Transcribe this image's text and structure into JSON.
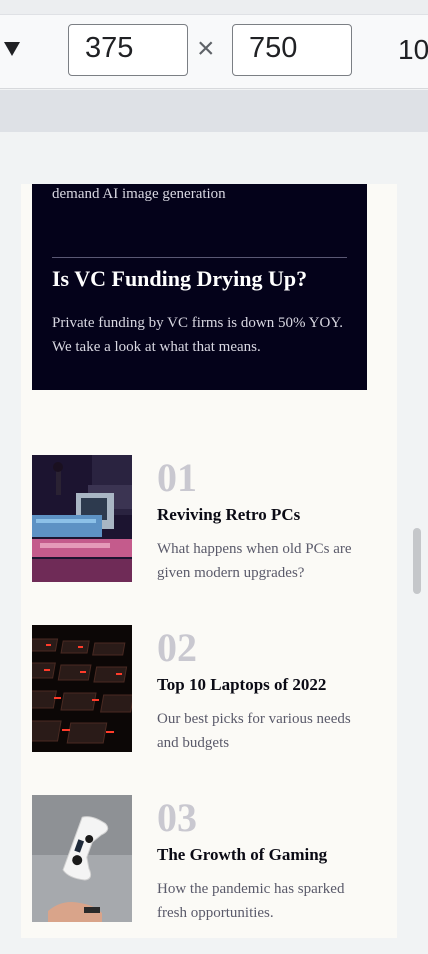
{
  "devtools": {
    "width_value": "375",
    "height_value": "750",
    "times_symbol": "×",
    "zoom_text": "10"
  },
  "featured": {
    "prev_description": "What are the possible adverse effects of on-demand AI image generation",
    "title": "Is VC Funding Drying Up?",
    "description": "Private funding by VC firms is down 50% YOY. We take a look at what that means."
  },
  "articles": [
    {
      "number": "01",
      "title": "Reviving Retro PCs",
      "description": "What happens when old PCs are given modern upgrades?",
      "image": "retro-pc-image"
    },
    {
      "number": "02",
      "title": "Top 10 Laptops of 2022",
      "description": "Our best picks for various needs and budgets",
      "image": "laptop-keyboard-image"
    },
    {
      "number": "03",
      "title": "The Growth of Gaming",
      "description": "How the pandemic has sparked fresh opportunities.",
      "image": "game-controller-image"
    }
  ],
  "colors": {
    "card_bg": "#04021a",
    "page_bg": "#fbfaf6",
    "number_color": "#c9c8d0"
  }
}
